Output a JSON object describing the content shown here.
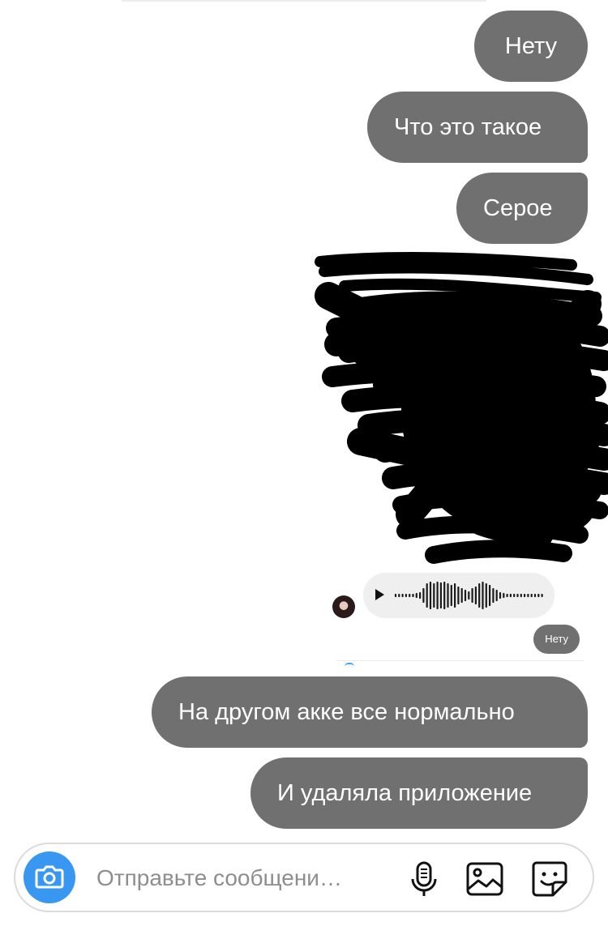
{
  "messages": [
    {
      "text": "Нету"
    },
    {
      "text": "Что это такое"
    },
    {
      "text": "Серое"
    },
    {
      "text": "На другом акке все нормально"
    },
    {
      "text": "И удаляла приложение"
    }
  ],
  "voice_message": {
    "type": "audio"
  },
  "reply_bubble": {
    "text": "Нету"
  },
  "composer": {
    "placeholder": "Отправьте сообщени…",
    "camera_icon": "camera-icon",
    "mic_icon": "microphone-icon",
    "gallery_icon": "image-icon",
    "sticker_icon": "sticker-icon"
  },
  "colors": {
    "bubble": "#707070",
    "accent": "#3897f0",
    "voice_bg": "#efefef"
  }
}
